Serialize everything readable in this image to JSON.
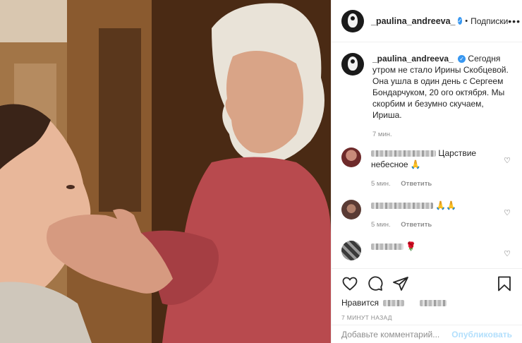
{
  "post": {
    "username": "_paulina_andreeva_",
    "verified_mark": "✓",
    "separator": "•",
    "follow_label": "Подписки",
    "more_label": "•••",
    "caption_text": "Сегодня утром не стало Ирины Скобцевой. Она ушла в один день с Сергеем Бондарчуком, 20 ого октября. Мы скорбим и безумно скучаем, Ириша.",
    "caption_time": "7 мин."
  },
  "comments": [
    {
      "text": "Царствие небесное 🙏",
      "time": "5 мин.",
      "reply": "Ответить",
      "avatar_color": "#6e2a2a"
    },
    {
      "text": "🙏🙏",
      "time": "5 мин.",
      "reply": "Ответить",
      "avatar_color": "#5a3b34"
    },
    {
      "text": "🌹",
      "avatar_color": "#3a3a3a"
    }
  ],
  "actions": {
    "likes_label": "Нравится",
    "posted_time": "7 МИНУТ НАЗАД",
    "add_comment_placeholder": "Добавьте комментарий...",
    "publish_label": "Опубликовать"
  },
  "icons": [
    "heart-icon",
    "comment-icon",
    "share-icon",
    "bookmark-icon",
    "small-heart-icon"
  ],
  "colors": {
    "accent": "#3897f0",
    "publish_disabled": "#b2dffc",
    "muted": "#8e8e8e"
  }
}
